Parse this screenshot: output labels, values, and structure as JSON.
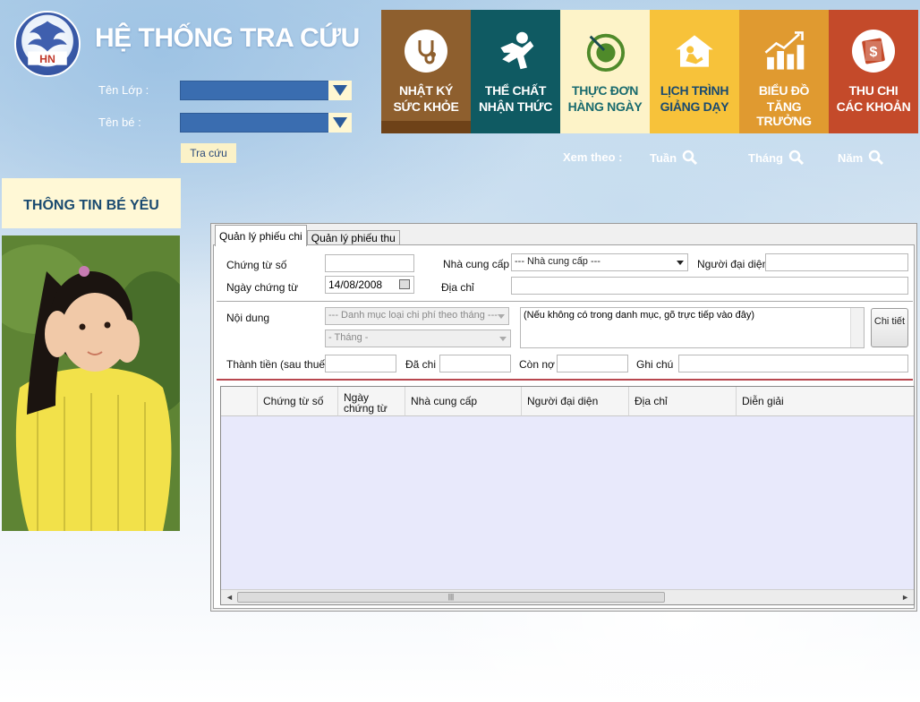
{
  "header": {
    "app_title": "HỆ THỐNG TRA CỨU",
    "logo_text": "HN",
    "class_label": "Tên Lớp :",
    "child_label": "Tên bé :",
    "search_button": "Tra cứu",
    "view_by_label": "Xem theo :",
    "view_options": [
      "Tuần",
      "Tháng",
      "Năm"
    ]
  },
  "tiles": [
    {
      "line1": "NHẬT KÝ",
      "line2": "SỨC KHỎE",
      "icon": "stethoscope-icon",
      "color": "#8e5f2e"
    },
    {
      "line1": "THỂ CHẤT",
      "line2": "NHẬN THỨC",
      "icon": "running-person-icon",
      "color": "#0f5a62"
    },
    {
      "line1": "THỰC ĐƠN",
      "line2": "HÀNG NGÀY",
      "icon": "plate-fork-icon",
      "color": "#fdf3c8"
    },
    {
      "line1": "LỊCH TRÌNH",
      "line2": "GIẢNG DẠY",
      "icon": "house-child-icon",
      "color": "#f7c23a"
    },
    {
      "line1": "BIỂU ĐỒ",
      "line2": "TĂNG TRƯỞNG",
      "icon": "growth-chart-icon",
      "color": "#e09a30"
    },
    {
      "line1": "THU CHI",
      "line2": "CÁC KHOẢN",
      "icon": "money-icon",
      "color": "#c44a2a"
    }
  ],
  "left_panel": {
    "info_title": "THÔNG TIN BÉ YÊU"
  },
  "form": {
    "tabs": [
      "Quản lý phiếu chi",
      "Quản lý phiếu thu"
    ],
    "voucher_no_label": "Chứng từ số",
    "voucher_no_value": "",
    "voucher_date_label": "Ngày chứng từ",
    "voucher_date_value": "14/08/2008",
    "supplier_label": "Nhà cung cấp",
    "supplier_value": "--- Nhà cung cấp ---",
    "representative_label": "Người đại diện",
    "address_label": "Địa chỉ",
    "content_label": "Nội dung",
    "category_value": "--- Danh mục loại chi phí theo tháng ---",
    "month_value": "- Tháng -",
    "content_text": "(Nếu không có trong danh mục, gõ trực tiếp vào đây)",
    "detail_button": "Chi tiết",
    "total_label": "Thành tiền (sau thuế)",
    "paid_label": "Đã chi",
    "remaining_label": "Còn nợ",
    "note_label": "Ghi chú"
  },
  "grid": {
    "columns": [
      "",
      "Chứng từ số",
      "Ngày chứng từ",
      "Nhà cung cấp",
      "Người đại diện",
      "Địa chỉ",
      "Diễn giải"
    ],
    "rows": []
  },
  "colors": {
    "tile_divider": "#ffffff",
    "accent_red_line": "#b8474f",
    "grid_background": "#e8e9fb"
  }
}
